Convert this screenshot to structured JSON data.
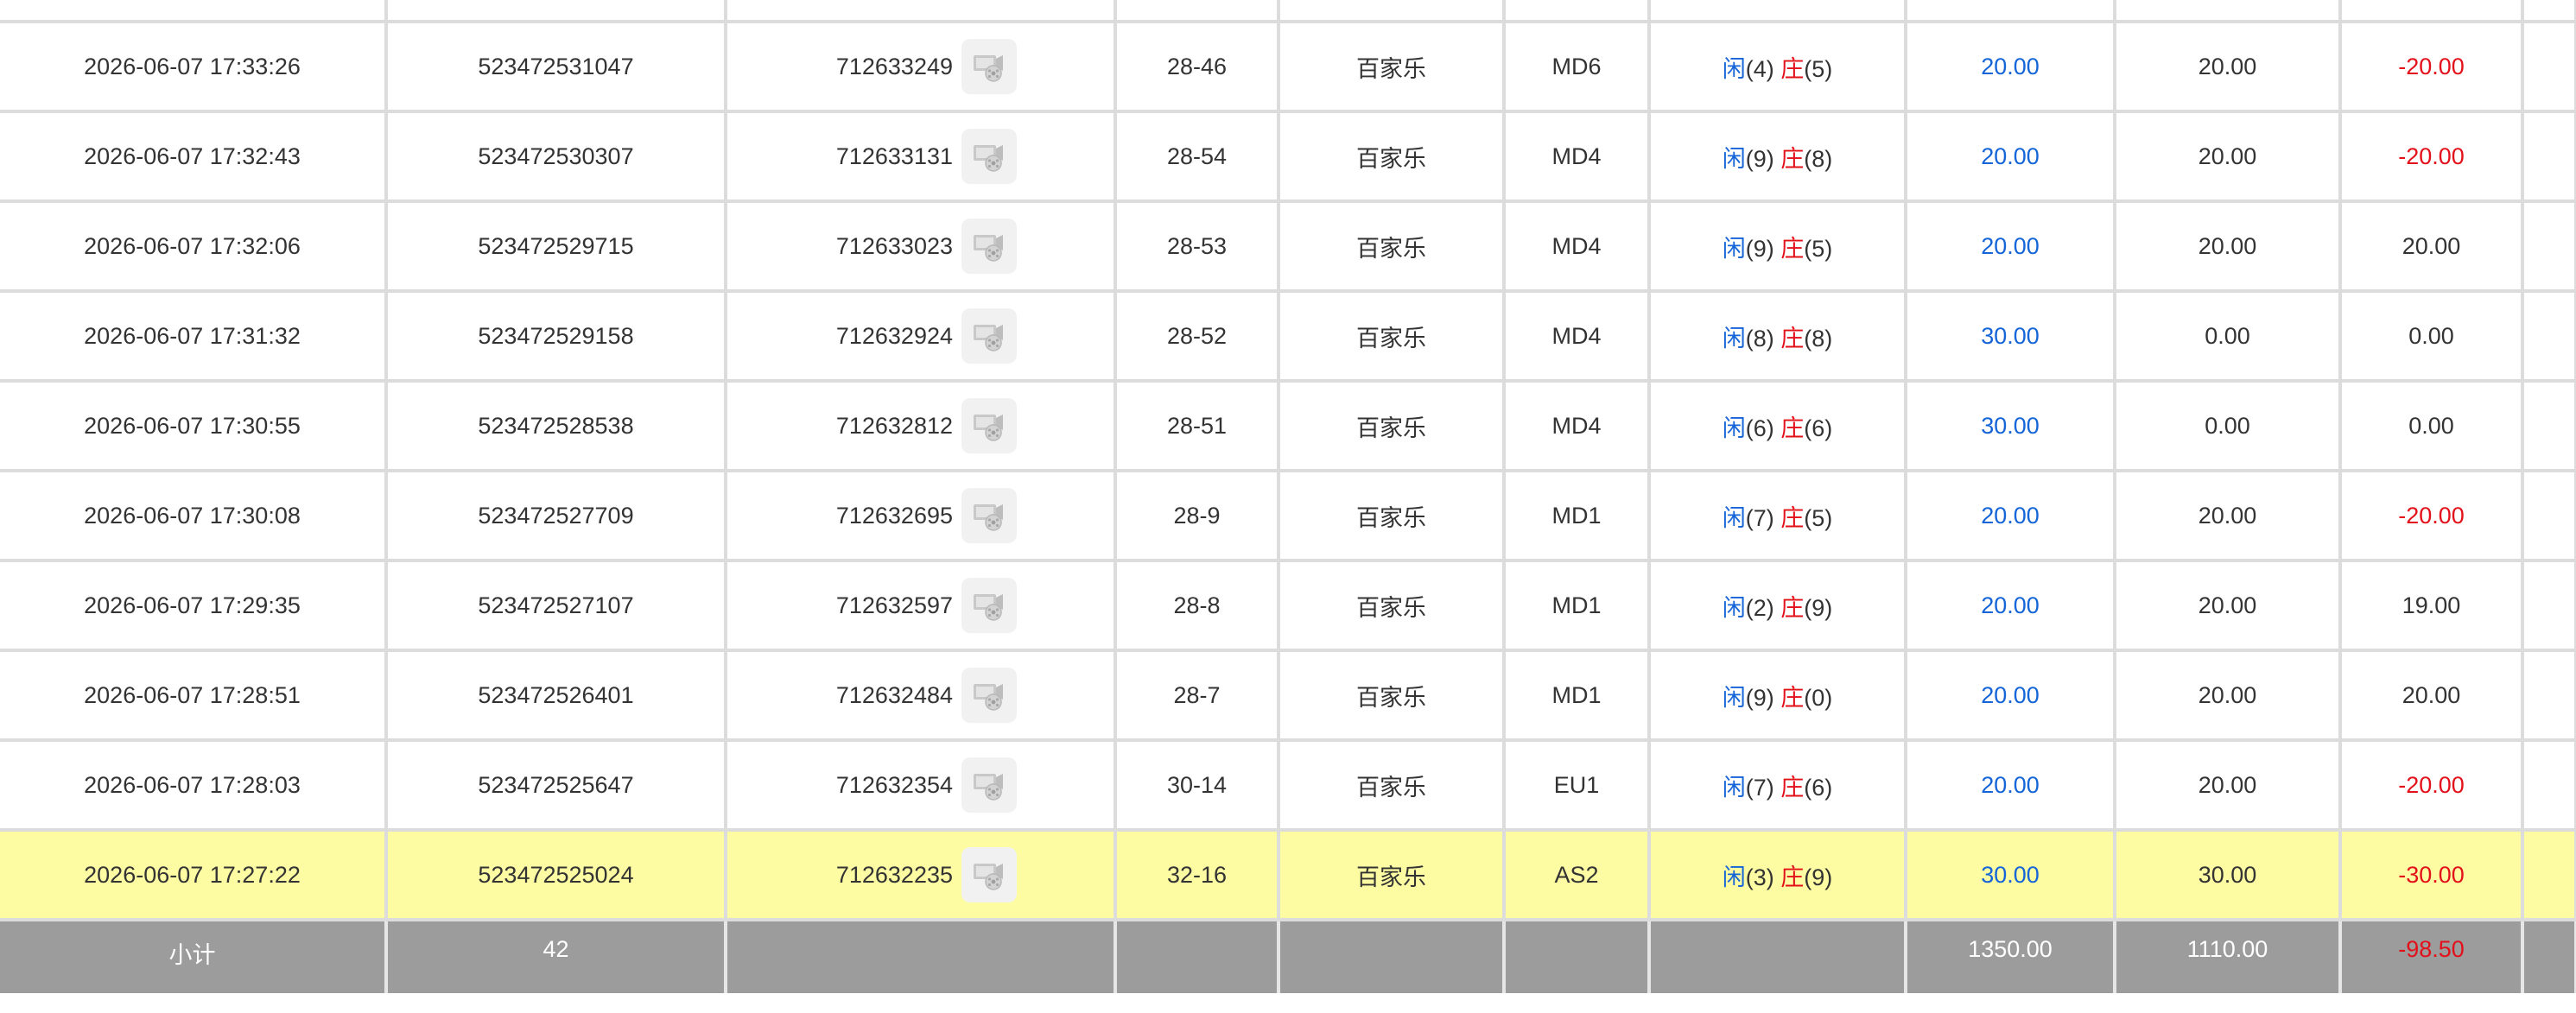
{
  "rows": [
    {
      "time": "2026-06-07 17:33:26",
      "bet_id": "523472531047",
      "round_id": "712633249",
      "shoe": "28-46",
      "game": "百家乐",
      "table": "MD6",
      "player_label": "闲",
      "player_score": "(4)",
      "banker_label": "庄",
      "banker_score": "(5)",
      "bet": "20.00",
      "valid_bet": "20.00",
      "win_loss": "-20.00",
      "win_loss_negative": true
    },
    {
      "time": "2026-06-07 17:32:43",
      "bet_id": "523472530307",
      "round_id": "712633131",
      "shoe": "28-54",
      "game": "百家乐",
      "table": "MD4",
      "player_label": "闲",
      "player_score": "(9)",
      "banker_label": "庄",
      "banker_score": "(8)",
      "bet": "20.00",
      "valid_bet": "20.00",
      "win_loss": "-20.00",
      "win_loss_negative": true
    },
    {
      "time": "2026-06-07 17:32:06",
      "bet_id": "523472529715",
      "round_id": "712633023",
      "shoe": "28-53",
      "game": "百家乐",
      "table": "MD4",
      "player_label": "闲",
      "player_score": "(9)",
      "banker_label": "庄",
      "banker_score": "(5)",
      "bet": "20.00",
      "valid_bet": "20.00",
      "win_loss": "20.00",
      "win_loss_negative": false
    },
    {
      "time": "2026-06-07 17:31:32",
      "bet_id": "523472529158",
      "round_id": "712632924",
      "shoe": "28-52",
      "game": "百家乐",
      "table": "MD4",
      "player_label": "闲",
      "player_score": "(8)",
      "banker_label": "庄",
      "banker_score": "(8)",
      "bet": "30.00",
      "valid_bet": "0.00",
      "win_loss": "0.00",
      "win_loss_negative": false
    },
    {
      "time": "2026-06-07 17:30:55",
      "bet_id": "523472528538",
      "round_id": "712632812",
      "shoe": "28-51",
      "game": "百家乐",
      "table": "MD4",
      "player_label": "闲",
      "player_score": "(6)",
      "banker_label": "庄",
      "banker_score": "(6)",
      "bet": "30.00",
      "valid_bet": "0.00",
      "win_loss": "0.00",
      "win_loss_negative": false
    },
    {
      "time": "2026-06-07 17:30:08",
      "bet_id": "523472527709",
      "round_id": "712632695",
      "shoe": "28-9",
      "game": "百家乐",
      "table": "MD1",
      "player_label": "闲",
      "player_score": "(7)",
      "banker_label": "庄",
      "banker_score": "(5)",
      "bet": "20.00",
      "valid_bet": "20.00",
      "win_loss": "-20.00",
      "win_loss_negative": true
    },
    {
      "time": "2026-06-07 17:29:35",
      "bet_id": "523472527107",
      "round_id": "712632597",
      "shoe": "28-8",
      "game": "百家乐",
      "table": "MD1",
      "player_label": "闲",
      "player_score": "(2)",
      "banker_label": "庄",
      "banker_score": "(9)",
      "bet": "20.00",
      "valid_bet": "20.00",
      "win_loss": "19.00",
      "win_loss_negative": false
    },
    {
      "time": "2026-06-07 17:28:51",
      "bet_id": "523472526401",
      "round_id": "712632484",
      "shoe": "28-7",
      "game": "百家乐",
      "table": "MD1",
      "player_label": "闲",
      "player_score": "(9)",
      "banker_label": "庄",
      "banker_score": "(0)",
      "bet": "20.00",
      "valid_bet": "20.00",
      "win_loss": "20.00",
      "win_loss_negative": false
    },
    {
      "time": "2026-06-07 17:28:03",
      "bet_id": "523472525647",
      "round_id": "712632354",
      "shoe": "30-14",
      "game": "百家乐",
      "table": "EU1",
      "player_label": "闲",
      "player_score": "(7)",
      "banker_label": "庄",
      "banker_score": "(6)",
      "bet": "20.00",
      "valid_bet": "20.00",
      "win_loss": "-20.00",
      "win_loss_negative": true
    },
    {
      "time": "2026-06-07 17:27:22",
      "bet_id": "523472525024",
      "round_id": "712632235",
      "shoe": "32-16",
      "game": "百家乐",
      "table": "AS2",
      "player_label": "闲",
      "player_score": "(3)",
      "banker_label": "庄",
      "banker_score": "(9)",
      "bet": "30.00",
      "valid_bet": "30.00",
      "win_loss": "-30.00",
      "win_loss_negative": true,
      "highlighted": true
    }
  ],
  "subtotal": {
    "label": "小计",
    "count": "42",
    "bet": "1350.00",
    "valid_bet": "1110.00",
    "win_loss": "-98.50"
  },
  "icons": {
    "replay": "replay-video-icon"
  },
  "colors": {
    "player_blue": "#1565d8",
    "banker_red": "#e3101a",
    "highlight": "#fdfca3",
    "subtotal_bg": "#9c9c9c"
  }
}
